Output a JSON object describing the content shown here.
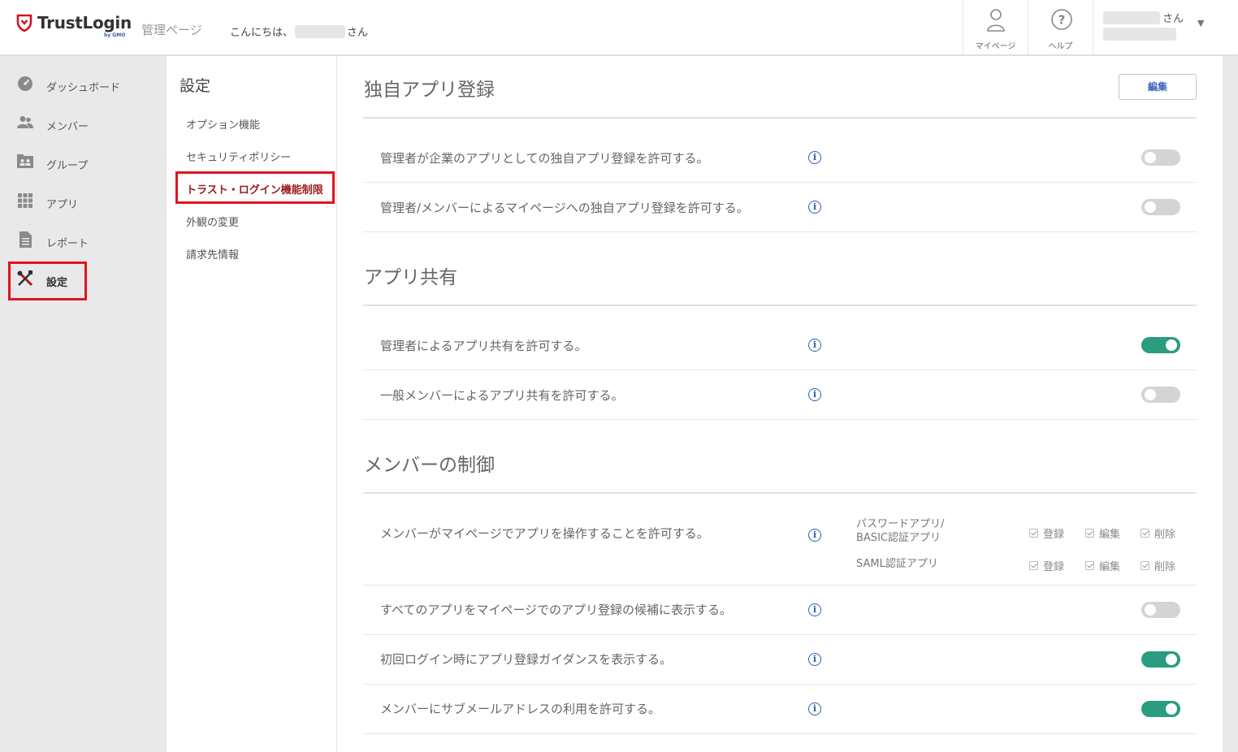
{
  "header": {
    "logo_text": "TrustLogin",
    "logo_sub": "by GMO",
    "admin_label": "管理ページ",
    "greeting_prefix": "こんにちは、",
    "greeting_suffix": "さん",
    "mypage_label": "マイページ",
    "help_label": "ヘルプ",
    "user_suffix": "さん",
    "caret": "▼"
  },
  "nav": {
    "items": [
      {
        "label": "ダッシュボード",
        "icon": "dashboard-icon"
      },
      {
        "label": "メンバー",
        "icon": "members-icon"
      },
      {
        "label": "グループ",
        "icon": "group-icon"
      },
      {
        "label": "アプリ",
        "icon": "apps-grid-icon"
      },
      {
        "label": "レポート",
        "icon": "report-icon"
      },
      {
        "label": "設定",
        "icon": "settings-tools-icon"
      }
    ],
    "active_index": 5
  },
  "submenu": {
    "title": "設定",
    "items": [
      {
        "label": "オプション機能"
      },
      {
        "label": "セキュリティポリシー"
      },
      {
        "label": "トラスト・ログイン機能制限"
      },
      {
        "label": "外観の変更"
      },
      {
        "label": "請求先情報"
      }
    ],
    "active_index": 2
  },
  "main": {
    "edit_label": "編集",
    "sections": [
      {
        "title": "独自アプリ登録",
        "rows": [
          {
            "text": "管理者が企業のアプリとしての独自アプリ登録を許可する。",
            "enabled": false
          },
          {
            "text": "管理者/メンバーによるマイページへの独自アプリ登録を許可する。",
            "enabled": false
          }
        ]
      },
      {
        "title": "アプリ共有",
        "rows": [
          {
            "text": "管理者によるアプリ共有を許可する。",
            "enabled": true
          },
          {
            "text": "一般メンバーによるアプリ共有を許可する。",
            "enabled": false
          }
        ]
      },
      {
        "title": "メンバーの制御",
        "permissions_row": {
          "text": "メンバーがマイページでアプリを操作することを許可する。",
          "groups": [
            {
              "label_line1": "パスワードアプリ/",
              "label_line2": "BASIC認証アプリ",
              "options": [
                {
                  "label": "登録",
                  "checked": true
                },
                {
                  "label": "編集",
                  "checked": true
                },
                {
                  "label": "削除",
                  "checked": true
                }
              ]
            },
            {
              "label_line1": "SAML認証アプリ",
              "label_line2": "",
              "options": [
                {
                  "label": "登録",
                  "checked": true
                },
                {
                  "label": "編集",
                  "checked": true
                },
                {
                  "label": "削除",
                  "checked": true
                }
              ]
            }
          ]
        },
        "rows": [
          {
            "text": "すべてのアプリをマイページでのアプリ登録の候補に表示する。",
            "enabled": false
          },
          {
            "text": "初回ログイン時にアプリ登録ガイダンスを表示する。",
            "enabled": true
          },
          {
            "text": "メンバーにサブメールアドレスの利用を許可する。",
            "enabled": true
          }
        ]
      }
    ]
  },
  "colors": {
    "accent_red": "#e0141e",
    "toggle_on": "#2a9c7f",
    "toggle_off": "#d4d4d4",
    "link_blue": "#2e5fb3"
  }
}
